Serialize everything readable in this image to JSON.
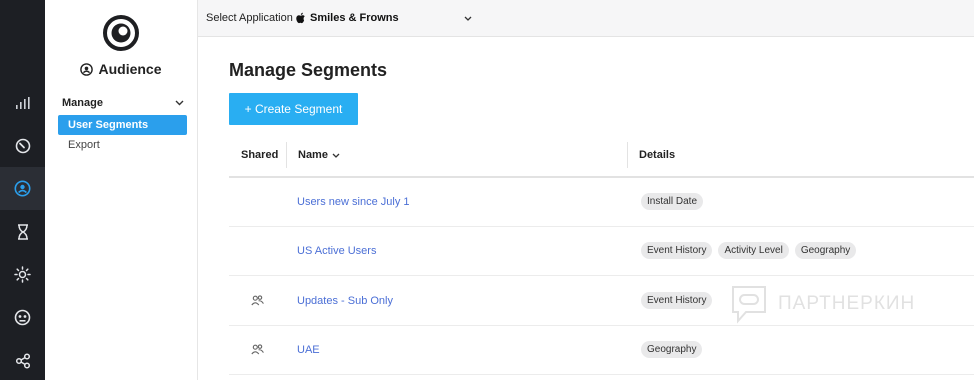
{
  "rail": {
    "items": [
      {
        "icon": "bar-chart-icon",
        "active": false
      },
      {
        "icon": "speedometer-icon",
        "active": false
      },
      {
        "icon": "audience-icon",
        "active": true
      },
      {
        "icon": "hourglass-icon",
        "active": false
      },
      {
        "icon": "sun-icon",
        "active": false
      },
      {
        "icon": "robot-face-icon",
        "active": false
      },
      {
        "icon": "share-nodes-icon",
        "active": false
      }
    ],
    "active_color": "#2b9fec"
  },
  "subnav": {
    "logo": "brand-logo-icon",
    "section": "Audience",
    "group_label": "Manage",
    "items": [
      {
        "label": "User Segments",
        "active": true
      },
      {
        "label": "Export",
        "active": false
      }
    ]
  },
  "topbar": {
    "label": "Select Application",
    "app_name": "Smiles & Frowns",
    "app_icon": "apple-icon"
  },
  "main": {
    "title": "Manage Segments",
    "create_button": "+ Create Segment",
    "columns": {
      "shared": "Shared",
      "name": "Name",
      "details": "Details"
    },
    "rows": [
      {
        "name": "Users new since July 1",
        "shared": false,
        "details": [
          "Install Date"
        ]
      },
      {
        "name": "US Active Users",
        "shared": false,
        "details": [
          "Event History",
          "Activity Level",
          "Geography"
        ]
      },
      {
        "name": "Updates - Sub Only",
        "shared": true,
        "details": [
          "Event History"
        ]
      },
      {
        "name": "UAE",
        "shared": true,
        "details": [
          "Geography"
        ]
      }
    ]
  },
  "watermark": "ПАРТНЕРКИН",
  "colors": {
    "accent": "#29aef2",
    "link": "#4b6fd6",
    "rail_bg": "#1d1f24"
  }
}
